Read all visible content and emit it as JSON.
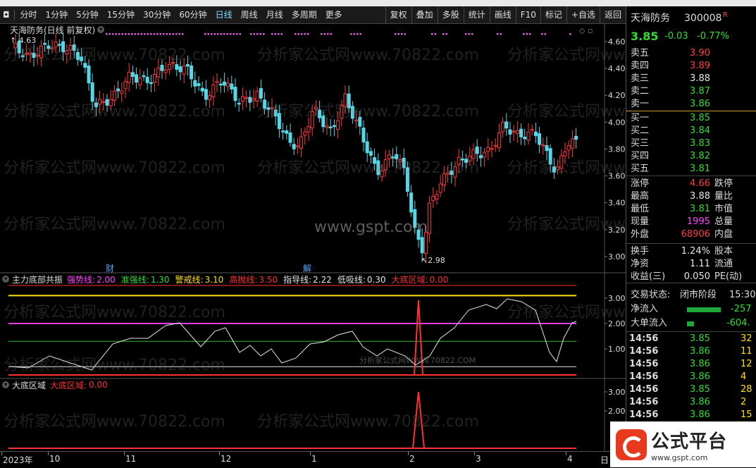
{
  "toolbar": {
    "left": [
      "分时",
      "1分钟",
      "5分钟",
      "15分钟",
      "30分钟",
      "60分钟",
      "日线",
      "周线",
      "月线",
      "多周期",
      "更多"
    ],
    "right": [
      "复权",
      "叠加",
      "多股",
      "统计",
      "画线",
      "F10",
      "标记",
      "+自选",
      "返回"
    ],
    "selected": "日线"
  },
  "main": {
    "title": "天海防务(日线 前复权)",
    "high_label": "4.63",
    "low_label": "2.98",
    "price_axis": [
      "4.60",
      "4.40",
      "4.20",
      "4.00",
      "3.80",
      "3.60",
      "3.40",
      "3.20",
      "3.00"
    ],
    "watermark_url": "www.gspt.com",
    "watermark": "分析家公式网www.70822.com",
    "marker_cai": "财",
    "marker_jie": "解"
  },
  "sub1": {
    "name": "主力底部共振",
    "items": [
      {
        "label": "强势线:",
        "value": "2.00",
        "color": "#ff44ff"
      },
      {
        "label": "准强线:",
        "value": "1.30",
        "color": "#33dd33"
      },
      {
        "label": "警戒线:",
        "value": "3.10",
        "color": "#ffe000"
      },
      {
        "label": "高抛线:",
        "value": "3.50",
        "color": "#ff3030"
      },
      {
        "label": "指导线:",
        "value": "2.22",
        "color": "#e6e6e6"
      },
      {
        "label": "低吸线:",
        "value": "0.30",
        "color": "#e6e6e6"
      },
      {
        "label": "大底区域:",
        "value": "0.00",
        "color": "#ff3030"
      }
    ],
    "axis": [
      "3.00",
      "2.00",
      "1.00"
    ],
    "watermark": "分析家公式网WWW.70822.COM"
  },
  "sub2": {
    "name": "大底区域",
    "item_label": "大底区域:",
    "item_value": "0.00",
    "axis": [
      "3.00",
      "2.00"
    ]
  },
  "dates": {
    "labels": [
      "2023年",
      "10",
      "11",
      "12",
      "1",
      "2",
      "3",
      "4"
    ],
    "tail": "日"
  },
  "panel": {
    "name": "天海防务",
    "code": "300008",
    "flag": "R",
    "price": "3.85",
    "change": "-0.03",
    "pct": "-0.77%",
    "asks": [
      {
        "label": "卖五",
        "price": "3.90"
      },
      {
        "label": "卖四",
        "price": "3.89"
      },
      {
        "label": "卖三",
        "price": "3.88"
      },
      {
        "label": "卖二",
        "price": "3.87"
      },
      {
        "label": "卖一",
        "price": "3.86"
      }
    ],
    "bids": [
      {
        "label": "买一",
        "price": "3.85"
      },
      {
        "label": "买二",
        "price": "3.84"
      },
      {
        "label": "买三",
        "price": "3.83"
      },
      {
        "label": "买四",
        "price": "3.82"
      },
      {
        "label": "买五",
        "price": "3.81"
      }
    ],
    "stats": [
      {
        "label": "涨停",
        "value": "4.66",
        "color": "#ff4040",
        "label2": "跌停"
      },
      {
        "label": "最高",
        "value": "3.88",
        "color": "#e6e6e6",
        "label2": "量比"
      },
      {
        "label": "最低",
        "value": "3.81",
        "color": "#33dd33",
        "label2": "市值"
      },
      {
        "label": "现量",
        "value": "1995",
        "color": "#ff44ff",
        "label2": "总量"
      },
      {
        "label": "外盘",
        "value": "68906",
        "color": "#ff4040",
        "label2": "内盘"
      }
    ],
    "stats2": [
      {
        "label": "换手",
        "value": "1.24%",
        "label2": "股本"
      },
      {
        "label": "净资",
        "value": "1.11",
        "label2": "流通"
      },
      {
        "label": "收益(三)",
        "value": "0.050",
        "label2": "PE(动)"
      }
    ],
    "trade_state_label": "交易状态:",
    "trade_state": "闭市阶段",
    "trade_time": "15:30",
    "flow": [
      {
        "label": "净流入",
        "value": "-257"
      },
      {
        "label": "大单流入",
        "value": "-604."
      }
    ],
    "ticks": [
      {
        "time": "14:56",
        "price": "3.85",
        "vol": "32"
      },
      {
        "time": "14:56",
        "price": "3.86",
        "vol": "11"
      },
      {
        "time": "14:56",
        "price": "3.86",
        "vol": "12"
      },
      {
        "time": "14:56",
        "price": "3.86",
        "vol": "4"
      },
      {
        "time": "14:56",
        "price": "3.85",
        "vol": "28"
      },
      {
        "time": "14:56",
        "price": "3.86",
        "vol": "2"
      },
      {
        "time": "14:56",
        "price": "3.86",
        "vol": "15"
      }
    ]
  },
  "logo": {
    "text": "公式平台",
    "url": "www.gspt.com"
  }
}
